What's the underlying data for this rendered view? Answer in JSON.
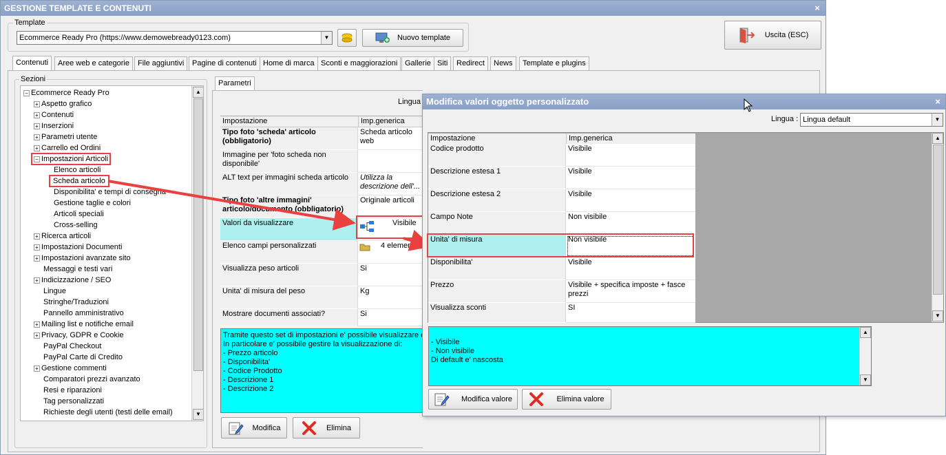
{
  "window": {
    "title": "GESTIONE TEMPLATE E CONTENUTI",
    "close": "×"
  },
  "template": {
    "group_label": "Template",
    "selected": "Ecommerce Ready Pro (https://www.demowebready0123.com)",
    "new_button": "Nuovo template"
  },
  "exit_button": "Uscita (ESC)",
  "tabs": [
    "Contenuti",
    "Aree web e categorie",
    "File aggiuntivi",
    "Pagine di contenuti",
    "Home di marca",
    "Sconti e maggiorazioni",
    "Gallerie",
    "Siti",
    "Redirect",
    "News",
    "Template e plugins"
  ],
  "sections": {
    "label": "Sezioni",
    "items": [
      {
        "label": "Ecommerce Ready Pro",
        "exp": "−"
      },
      {
        "label": "Aspetto grafico",
        "exp": "+"
      },
      {
        "label": "Contenuti",
        "exp": "+"
      },
      {
        "label": "Inserzioni",
        "exp": "+"
      },
      {
        "label": "Parametri utente",
        "exp": "+"
      },
      {
        "label": "Carrello ed Ordini",
        "exp": "+"
      },
      {
        "label": "Impostazioni Articoli",
        "exp": "−"
      },
      {
        "label": "Elenco articoli",
        "exp": ""
      },
      {
        "label": "Scheda articolo",
        "exp": ""
      },
      {
        "label": "Disponibilita' e tempi di consegna",
        "exp": ""
      },
      {
        "label": "Gestione taglie e colori",
        "exp": ""
      },
      {
        "label": "Articoli speciali",
        "exp": ""
      },
      {
        "label": "Cross-selling",
        "exp": ""
      },
      {
        "label": "Ricerca articoli",
        "exp": "+"
      },
      {
        "label": "Impostazioni Documenti",
        "exp": "+"
      },
      {
        "label": "Impostazioni avanzate sito",
        "exp": "+"
      },
      {
        "label": "Messaggi e testi vari",
        "exp": ""
      },
      {
        "label": "Indicizzazione / SEO",
        "exp": "+"
      },
      {
        "label": "Lingue",
        "exp": ""
      },
      {
        "label": "Stringhe/Traduzioni",
        "exp": ""
      },
      {
        "label": "Pannello amministrativo",
        "exp": ""
      },
      {
        "label": "Mailing list e notifiche email",
        "exp": "+"
      },
      {
        "label": "Privacy, GDPR e Cookie",
        "exp": "+"
      },
      {
        "label": "PayPal Checkout",
        "exp": ""
      },
      {
        "label": "PayPal Carte di Credito",
        "exp": ""
      },
      {
        "label": "Gestione commenti",
        "exp": "+"
      },
      {
        "label": "Comparatori prezzi avanzato",
        "exp": ""
      },
      {
        "label": "Resi e riparazioni",
        "exp": ""
      },
      {
        "label": "Tag personalizzati",
        "exp": ""
      },
      {
        "label": "Richieste degli utenti (testi delle email)",
        "exp": ""
      }
    ]
  },
  "params": {
    "tab": "Parametri",
    "lingua_label": "Lingua",
    "col_setting": "Impostazione",
    "col_value": "Imp.generica",
    "rows": [
      {
        "key": "Tipo foto 'scheda' articolo (obbligatorio)",
        "value": "Scheda articolo web",
        "bold": true
      },
      {
        "key": "Immagine per 'foto scheda non disponibile'",
        "value": ""
      },
      {
        "key": "ALT text per immagini scheda articolo",
        "value": "Utilizza la descrizione dell'...",
        "italic": true
      },
      {
        "key": "Tipo foto 'altre immagini' articolo/documento (obbligatorio)",
        "value": "Originale articoli",
        "bold": true
      },
      {
        "key": "Valori da visualizzare",
        "value": "Visibile"
      },
      {
        "key": "Elenco campi personalizzati",
        "value": "4 elementi"
      },
      {
        "key": "Visualizza peso articoli",
        "value": "Si"
      },
      {
        "key": "Unita' di misura del peso",
        "value": "Kg"
      },
      {
        "key": "Mostrare documenti associati?",
        "value": "Si"
      }
    ],
    "description": "Tramite questo set di impostazioni e' possibile visualizzare o m\nIn particolare e' possibile gestire la visualizzazione di:\n- Prezzo articolo\n- Disponibilita'\n- Codice Prodotto\n- Descrizione 1\n- Descrizione 2",
    "edit_button": "Modifica",
    "delete_button": "Elimina"
  },
  "dialog": {
    "title": "Modifica valori oggetto personalizzato",
    "close": "×",
    "lingua_label": "Lingua :",
    "lingua_value": "Lingua default",
    "col_setting": "Impostazione",
    "col_value": "Imp.generica",
    "rows": [
      {
        "key": "Codice prodotto",
        "value": "Visibile"
      },
      {
        "key": "Descrizione estesa 1",
        "value": "Visibile"
      },
      {
        "key": "Descrizione estesa 2",
        "value": "Visibile"
      },
      {
        "key": "Campo Note",
        "value": "Non visibile"
      },
      {
        "key": "Unita' di misura",
        "value": "Non visibile"
      },
      {
        "key": "Disponibilita'",
        "value": "Visibile"
      },
      {
        "key": "Prezzo",
        "value": "Visibile + specifica imposte + fasce prezzi"
      },
      {
        "key": "Visualizza sconti",
        "value": "SI"
      }
    ],
    "description": "- Visibile\n- Non visibile\nDi default e' nascosta",
    "edit_button": "Modifica valore",
    "delete_button": "Elimina valore"
  },
  "colors": {
    "highlight": "#e8413f",
    "cyan": "#00ffff",
    "selected_row": "#aef0f0",
    "title_bar": "#92a8cc"
  }
}
